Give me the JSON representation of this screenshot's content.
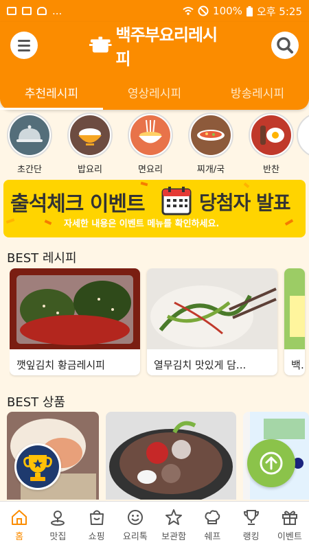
{
  "status_bar": {
    "left_icons": [
      "image-icon",
      "radio-icon",
      "pot-icon",
      "more-dots"
    ],
    "more": "...",
    "battery": "100%",
    "time": "오후 5:25"
  },
  "header": {
    "brand": "백주부요리레시피",
    "tabs": [
      {
        "label": "추천레시피",
        "active": true
      },
      {
        "label": "영상레시피",
        "active": false
      },
      {
        "label": "방송레시피",
        "active": false
      }
    ]
  },
  "categories": [
    {
      "label": "초간단",
      "icon": "cloche-icon",
      "color": "#546e7a"
    },
    {
      "label": "밥요리",
      "icon": "rice-bowl-icon",
      "color": "#f6a623"
    },
    {
      "label": "면요리",
      "icon": "noodle-bowl-icon",
      "color": "#e8734a"
    },
    {
      "label": "찌개/국",
      "icon": "stew-pot-icon",
      "color": "#8d5a3b"
    },
    {
      "label": "반찬",
      "icon": "fried-egg-icon",
      "color": "#c0392b"
    }
  ],
  "banner": {
    "title_left": "출석체크 이벤트",
    "title_right": "당첨자 발표",
    "subtitle": "자세한 내용은 이벤트 메뉴를 확인하세요."
  },
  "best_recipes": {
    "title": "BEST 레시피",
    "items": [
      {
        "title": "깻잎김치 황금레시피"
      },
      {
        "title": "열무김치 맛있게 담..."
      },
      {
        "title": "백"
      }
    ]
  },
  "best_products": {
    "title": "BEST 상품"
  },
  "bottom_nav": [
    {
      "label": "홈",
      "icon": "home-icon",
      "active": true
    },
    {
      "label": "맛집",
      "icon": "location-pin-icon",
      "active": false
    },
    {
      "label": "쇼핑",
      "icon": "shopping-bag-icon",
      "active": false
    },
    {
      "label": "요리톡",
      "icon": "smile-icon",
      "active": false
    },
    {
      "label": "보관함",
      "icon": "star-icon",
      "active": false
    },
    {
      "label": "쉐프",
      "icon": "chef-hat-icon",
      "active": false
    },
    {
      "label": "랭킹",
      "icon": "trophy-icon",
      "active": false
    },
    {
      "label": "이벤트",
      "icon": "gift-icon",
      "active": false
    }
  ],
  "colors": {
    "primary": "#fb8c00",
    "background": "#fff6e6",
    "banner": "#ffd400",
    "fab": "#8bc34a"
  }
}
